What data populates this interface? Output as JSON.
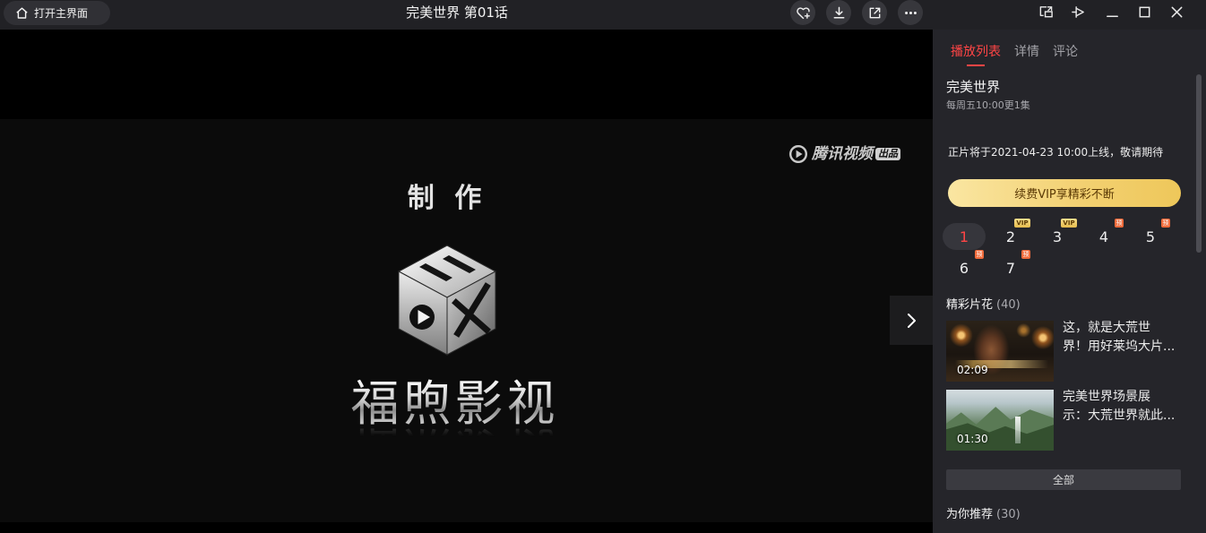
{
  "window": {
    "home_button": {
      "label": "打开主界面",
      "icon": "home-icon"
    },
    "title": "完美世界 第01话",
    "actions": [
      "heart-plus-icon",
      "download-icon",
      "external-link-icon",
      "more-icon"
    ],
    "controls": [
      "picture-in-picture-icon",
      "pin-icon",
      "minimize-icon",
      "maximize-icon",
      "close-icon"
    ]
  },
  "video": {
    "watermark": {
      "brand": "腾讯视频",
      "badge": "出品",
      "icon": "tencent-video-logo"
    },
    "credit_label": "制 作",
    "studio_logo": "cube-logo",
    "studio_name": "福煦影视",
    "next_icon": "chevron-right-icon"
  },
  "panel": {
    "tabs": [
      {
        "label": "播放列表",
        "active": true
      },
      {
        "label": "详情",
        "active": false
      },
      {
        "label": "评论",
        "active": false
      }
    ],
    "show": {
      "title": "完美世界",
      "schedule": "每周五10:00更1集",
      "notice": "正片将于2021-04-23 10:00上线，敬请期待"
    },
    "vip_button": "续费VIP享精彩不断",
    "episodes": [
      {
        "number": "1",
        "selected": true
      },
      {
        "number": "2",
        "selected": false,
        "badge": "VIP"
      },
      {
        "number": "3",
        "selected": false,
        "badge": "VIP"
      },
      {
        "number": "4",
        "selected": false,
        "badge": "预"
      },
      {
        "number": "5",
        "selected": false,
        "badge": "预"
      },
      {
        "number": "6",
        "selected": false,
        "badge": "预"
      },
      {
        "number": "7",
        "selected": false,
        "badge": "预"
      }
    ],
    "clips_section": {
      "title": "精彩片花",
      "count": "(40)"
    },
    "clips": [
      {
        "duration": "02:09",
        "title_lines": [
          "这，就是大荒世",
          "界！用好莱坞大片..."
        ]
      },
      {
        "duration": "01:30",
        "title_lines": [
          "完美世界场景展",
          "示：大荒世界就此..."
        ]
      }
    ],
    "all_button": "全部",
    "recommend_section": {
      "title": "为你推荐",
      "count": "(30)"
    }
  },
  "colors": {
    "accent": "#ff4545",
    "vip_gold": "#f0cb60",
    "preview_badge": "#ef6a3a",
    "panel_bg": "#25252a",
    "topbar_bg": "#212125"
  }
}
